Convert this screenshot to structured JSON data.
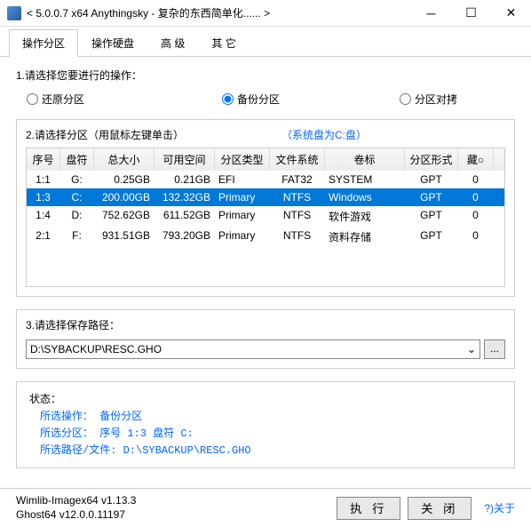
{
  "title": "< 5.0.0.7 x64 Anythingsky - 复杂的东西简单化...... >",
  "tabs": [
    "操作分区",
    "操作硬盘",
    "高  级",
    "其  它"
  ],
  "section1": "1.请选择您要进行的操作：",
  "radios": {
    "restore": "还原分区",
    "backup": "备份分区",
    "clone": "分区对拷"
  },
  "section2": "2.请选择分区（用鼠标左键单击）",
  "sysdisk": "（系统盘为C:盘）",
  "headers": [
    "序号",
    "盘符",
    "总大小",
    "可用空间",
    "分区类型",
    "文件系统",
    "卷标",
    "分区形式",
    "藏○"
  ],
  "rows": [
    {
      "seq": "1:1",
      "drv": "G:",
      "total": "0.25GB",
      "free": "0.21GB",
      "ptype": "EFI",
      "fs": "FAT32",
      "label": "SYSTEM",
      "scheme": "GPT",
      "hide": "0",
      "sel": false
    },
    {
      "seq": "1:3",
      "drv": "C:",
      "total": "200.00GB",
      "free": "132.32GB",
      "ptype": "Primary",
      "fs": "NTFS",
      "label": "Windows",
      "scheme": "GPT",
      "hide": "0",
      "sel": true
    },
    {
      "seq": "1:4",
      "drv": "D:",
      "total": "752.62GB",
      "free": "611.52GB",
      "ptype": "Primary",
      "fs": "NTFS",
      "label": "软件游戏",
      "scheme": "GPT",
      "hide": "0",
      "sel": false
    },
    {
      "seq": "2:1",
      "drv": "F:",
      "total": "931.51GB",
      "free": "793.20GB",
      "ptype": "Primary",
      "fs": "NTFS",
      "label": "资料存储",
      "scheme": "GPT",
      "hide": "0",
      "sel": false
    }
  ],
  "section3": "3.请选择保存路径：",
  "path": "D:\\SYBACKUP\\RESC.GHO",
  "browse": "...",
  "status_label": "状态：",
  "status": {
    "op": "所选操作： 备份分区",
    "part": "所选分区：  序号 1:3        盘符 C:",
    "file": "所选路径/文件: D:\\SYBACKUP\\RESC.GHO"
  },
  "versions": {
    "wim": "Wimlib-Imagex64 v1.13.3",
    "ghost": "Ghost64 v12.0.0.11197"
  },
  "buttons": {
    "exec": "执 行",
    "close": "关 闭",
    "about": "?)关于"
  }
}
